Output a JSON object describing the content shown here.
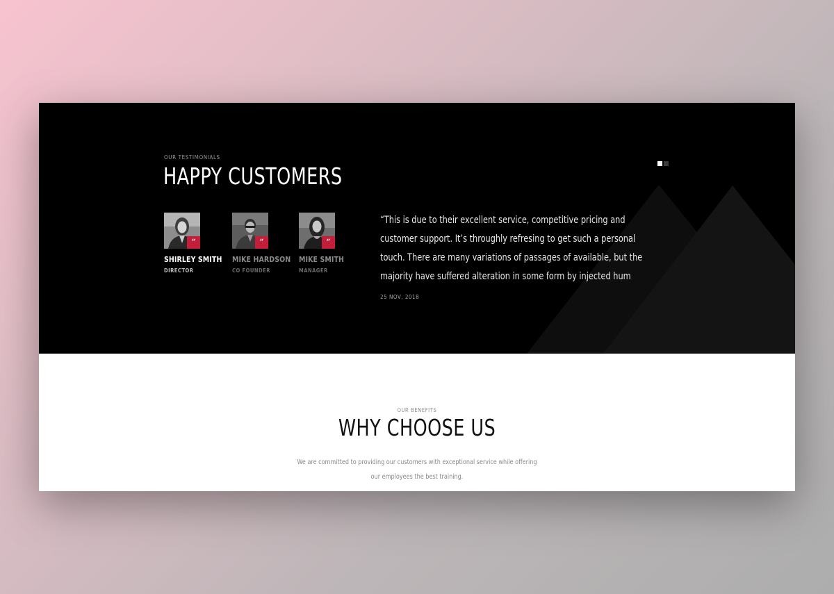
{
  "testimonials": {
    "eyebrow": "OUR TESTIMONIALS",
    "title": "HAPPY CUSTOMERS",
    "people": [
      {
        "name": "SHIRLEY SMITH",
        "role": "DIRECTOR",
        "active": true
      },
      {
        "name": "MIKE HARDSON",
        "role": "CO FOUNDER",
        "active": false
      },
      {
        "name": "MIKE SMITH",
        "role": "MANAGER",
        "active": false
      }
    ],
    "quote_badge": "“",
    "quote": "“This is due to their excellent service, competitive pricing and customer support. It’s throughly refresing to get such a personal touch. There are many variations of passages of available, but the majority have suffered alteration in some form by injected hum",
    "date": "25 NOV, 2018",
    "slider": {
      "total": 2,
      "active": 1
    }
  },
  "benefits": {
    "eyebrow": "OUR BENEFITS",
    "title": "WHY CHOOSE US",
    "text": "We are committed to providing our customers with exceptional service while offering our employees the best training."
  },
  "colors": {
    "accent": "#c41e3a",
    "dark_bg": "#000000",
    "light_bg": "#ffffff",
    "page_gradient_start": "#f7c3cf",
    "page_gradient_end": "#adadad"
  }
}
